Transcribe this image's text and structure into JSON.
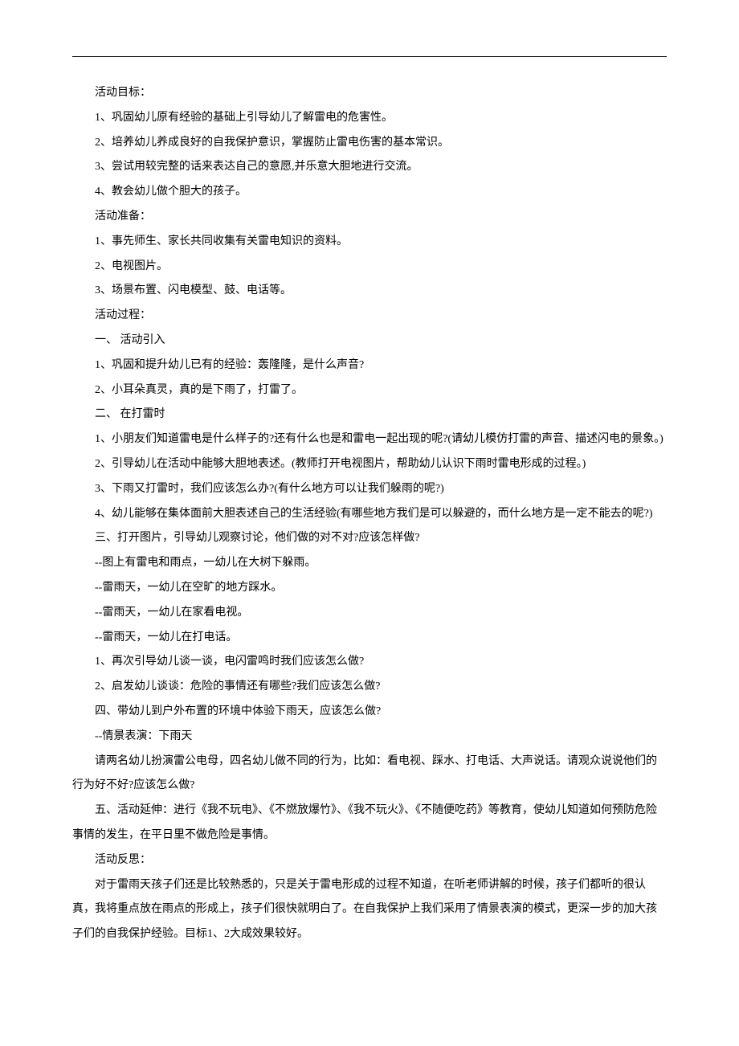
{
  "lines": [
    "活动目标：",
    "1、巩固幼儿原有经验的基础上引导幼儿了解雷电的危害性。",
    "2、培养幼儿养成良好的自我保护意识，掌握防止雷电伤害的基本常识。",
    "3、尝试用较完整的话来表达自己的意愿,并乐意大胆地进行交流。",
    "4、教会幼儿做个胆大的孩子。",
    "活动准备：",
    "1、事先师生、家长共同收集有关雷电知识的资料。",
    "2、电视图片。",
    "3、场景布置、闪电模型、鼓、电话等。",
    "活动过程：",
    "一、 活动引入",
    "1、巩固和提升幼儿已有的经验：轰隆隆，是什么声音?",
    "2、小耳朵真灵，真的是下雨了，打雷了。",
    "二、 在打雷时",
    "1、小朋友们知道雷电是什么样子的?还有什么也是和雷电一起出现的呢?(请幼儿模仿打雷的声音、描述闪电的景象。)",
    "2、引导幼儿在活动中能够大胆地表述。(教师打开电视图片，帮助幼儿认识下雨时雷电形成的过程。)",
    "3、下雨又打雷时，我们应该怎么办?(有什么地方可以让我们躲雨的呢?)",
    "4、幼儿能够在集体面前大胆表述自己的生活经验(有哪些地方我们是可以躲避的，而什么地方是一定不能去的呢?)",
    "三、打开图片，引导幼儿观察讨论，他们做的对不对?应该怎样做?",
    "--图上有雷电和雨点，一幼儿在大树下躲雨。",
    "--雷雨天，一幼儿在空旷的地方踩水。",
    "--雷雨天，一幼儿在家看电视。",
    "--雷雨天，一幼儿在打电话。",
    "1、再次引导幼儿谈一谈，电闪雷鸣时我们应该怎么做?",
    "2、启发幼儿谈谈：危险的事情还有哪些?我们应该怎么做?",
    "四、带幼儿到户外布置的环境中体验下雨天，应该怎么做?",
    "--情景表演：下雨天",
    "请两名幼儿扮演雷公电母，四名幼儿做不同的行为，比如：看电视、踩水、打电话、大声说话。请观众说说他们的行为好不好?应该怎么做?",
    "五、活动延伸：进行《我不玩电》、《不燃放爆竹》、《我不玩火》、《不随便吃药》等教育，使幼儿知道如何预防危险事情的发生，在平日里不做危险是事情。",
    "活动反思：",
    "对于雷雨天孩子们还是比较熟悉的，只是关于雷电形成的过程不知道，在听老师讲解的时候，孩子们都听的很认真，我将重点放在雨点的形成上，孩子们很快就明白了。在自我保护上我们采用了情景表演的模式，更深一步的加大孩子们的自我保护经验。目标1、2大成效果较好。"
  ],
  "indent_flags": [
    true,
    true,
    true,
    true,
    true,
    true,
    true,
    true,
    true,
    true,
    true,
    true,
    true,
    true,
    true,
    true,
    true,
    true,
    true,
    true,
    true,
    true,
    true,
    true,
    true,
    true,
    true,
    true,
    true,
    true,
    true
  ]
}
